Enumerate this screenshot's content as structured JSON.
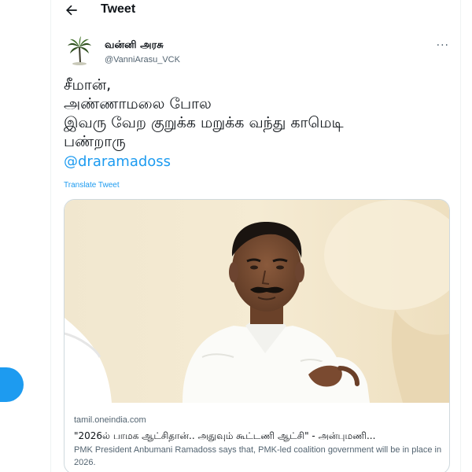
{
  "header": {
    "title": "Tweet",
    "back_icon": "arrow-left-icon"
  },
  "author": {
    "display_name": "வன்னி அரசு",
    "handle": "@VanniArasu_VCK",
    "avatar_icon": "palm-tree-avatar",
    "more_icon": "ellipsis-icon",
    "more_label": "···"
  },
  "tweet": {
    "lines": [
      "சீமான்,",
      "அண்ணாமலை போல",
      "இவரு வேற குறுக்க மறுக்க வந்து காமெடி",
      "பண்றாரு"
    ],
    "mention": "@draramadoss",
    "translate_label": "Translate Tweet"
  },
  "card": {
    "image_icon": "person-photo",
    "domain": "tamil.oneindia.com",
    "title": "\"2026ல் பாமக ஆட்சிதான்.. அதுவும் கூட்டணி ஆட்சி\" - அன்புமணி...",
    "description": "PMK President Anbumani Ramadoss says that, PMK-led coalition government will be in place in 2026."
  },
  "sidebar": {
    "tweet_button_icon": "compose-button"
  },
  "colors": {
    "accent": "#1d9bf0",
    "text": "#0f1419",
    "secondary": "#536471",
    "border": "#cfd9de"
  }
}
